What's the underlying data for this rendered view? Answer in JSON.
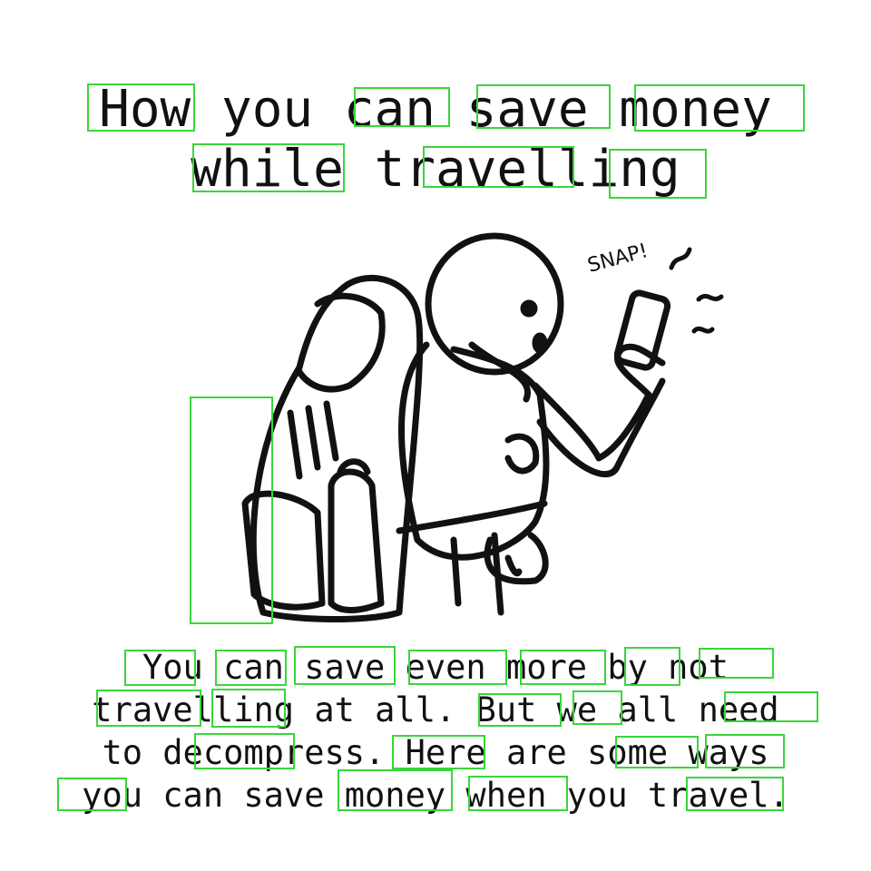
{
  "title": {
    "line1": "How you can save money",
    "line2": "while travelling"
  },
  "illustration": {
    "sound_text": "SNAP!",
    "stroke_color": "#111111"
  },
  "body": {
    "line1": "You can save even more by not",
    "line2": "travelling at all. But we all need",
    "line3": "to decompress. Here are some ways",
    "line4": "you can save money when you travel."
  },
  "colors": {
    "background": "#ffffff",
    "text": "#111111",
    "annotation_box": "#3ad63a"
  }
}
